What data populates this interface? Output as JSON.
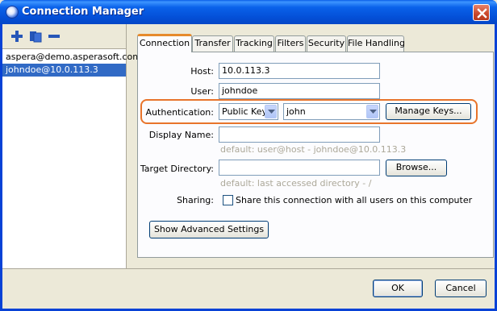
{
  "window": {
    "title": "Connection Manager"
  },
  "toolbar": {
    "add": "add-icon",
    "duplicate": "duplicate-icon",
    "remove": "remove-icon"
  },
  "hosts": [
    {
      "label": "aspera@demo.asperasoft.com"
    },
    {
      "label": "johndoe@10.0.113.3"
    }
  ],
  "tabs": [
    {
      "label": "Connection"
    },
    {
      "label": "Transfer"
    },
    {
      "label": "Tracking"
    },
    {
      "label": "Filters"
    },
    {
      "label": "Security"
    },
    {
      "label": "File Handling"
    }
  ],
  "form": {
    "host_label": "Host:",
    "host_value": "10.0.113.3",
    "user_label": "User:",
    "user_value": "johndoe",
    "auth_label": "Authentication:",
    "auth_type": "Public Key",
    "auth_key": "john",
    "manage_keys": "Manage Keys...",
    "display_name_label": "Display Name:",
    "display_name_value": "",
    "display_name_hint": "default: user@host - johndoe@10.0.113.3",
    "target_dir_label": "Target Directory:",
    "target_dir_value": "",
    "browse": "Browse...",
    "target_dir_hint": "default: last accessed directory - /",
    "sharing_label": "Sharing:",
    "sharing_text": "Share this connection with all users on this computer",
    "advanced": "Show Advanced Settings"
  },
  "footer": {
    "ok": "OK",
    "cancel": "Cancel"
  },
  "colors": {
    "highlight": "#e8742b",
    "selection": "#316ac5",
    "titlebar": "#0a5fe8"
  }
}
